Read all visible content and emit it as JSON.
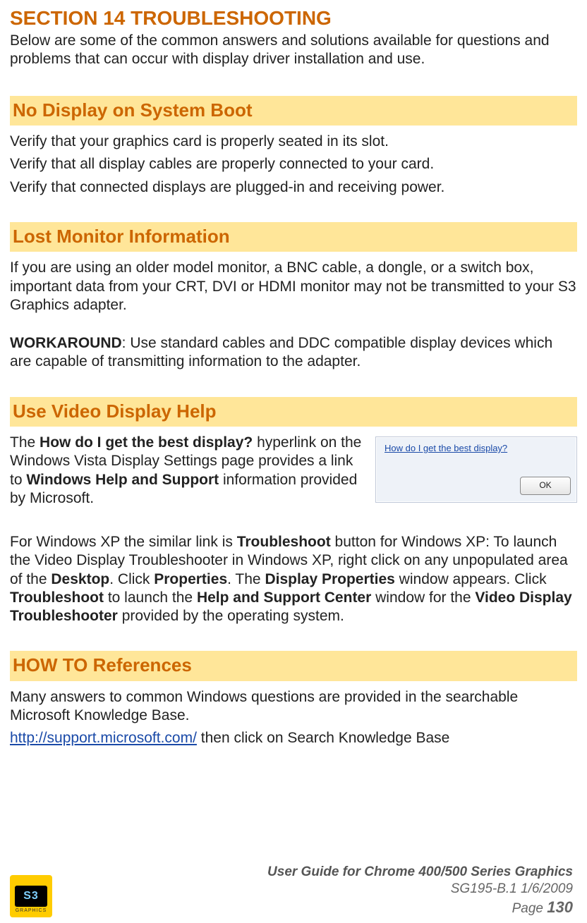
{
  "section": {
    "title": "SECTION 14  TROUBLESHOOTING",
    "intro": "Below are some of the common answers and solutions available for questions and problems that can occur with display driver installation and use."
  },
  "noDisplay": {
    "heading": "No Display on System Boot",
    "line1": "Verify that your graphics card is properly seated in its slot.",
    "line2": "Verify that all display cables are properly connected to your card.",
    "line3": "Verify that connected displays are plugged-in and receiving power."
  },
  "lostMonitor": {
    "heading": "Lost Monitor Information",
    "para1": "If you are using an older model monitor, a BNC cable, a dongle, or a switch box, important data from your CRT, DVI or HDMI monitor may not be transmitted to your S3 Graphics adapter.",
    "workaround_label": "WORKAROUND",
    "workaround_text": ": Use standard cables and DDC compatible display devices which are capable of transmitting information to the adapter."
  },
  "videoHelp": {
    "heading": "Use Video Display Help",
    "p1_a": "The ",
    "p1_bold1": "How do I get the best display?",
    "p1_b": " hyperlink on the Windows Vista Display Settings page provides a link to ",
    "p1_bold2": "Windows Help and Support",
    "p1_c": " information provided by Microsoft.",
    "mini_link": "How do I get the best display?",
    "mini_ok": "OK",
    "p2_a": "For Windows XP the similar link is ",
    "p2_b1": "Troubleshoot",
    "p2_b": " button for Windows XP: To launch the Video Display Troubleshooter in Windows XP, right click on any unpopulated area of the ",
    "p2_b2": "Desktop",
    "p2_c": ". Click ",
    "p2_b3": "Properties",
    "p2_d": ". The ",
    "p2_b4": "Display Properties",
    "p2_e": " window appears. Click ",
    "p2_b5": "Troubleshoot",
    "p2_f": " to launch the ",
    "p2_b6": "Help and Support Center",
    "p2_g": " window for the ",
    "p2_b7": "Video Display Troubleshooter",
    "p2_h": " provided by the operating system."
  },
  "howto": {
    "heading": "HOW TO References",
    "para1": "Many answers to common Windows questions are provided in the searchable Microsoft Knowledge Base.",
    "link": "http://support.microsoft.com/",
    "after_link": " then click on Search Knowledge Base"
  },
  "footer": {
    "logo_text": "S3",
    "logo_sub": "GRAPHICS",
    "line1": "User Guide for Chrome 400/500 Series Graphics",
    "line2": "SG195-B.1   1/6/2009",
    "page_label": "Page ",
    "page_num": "130"
  }
}
